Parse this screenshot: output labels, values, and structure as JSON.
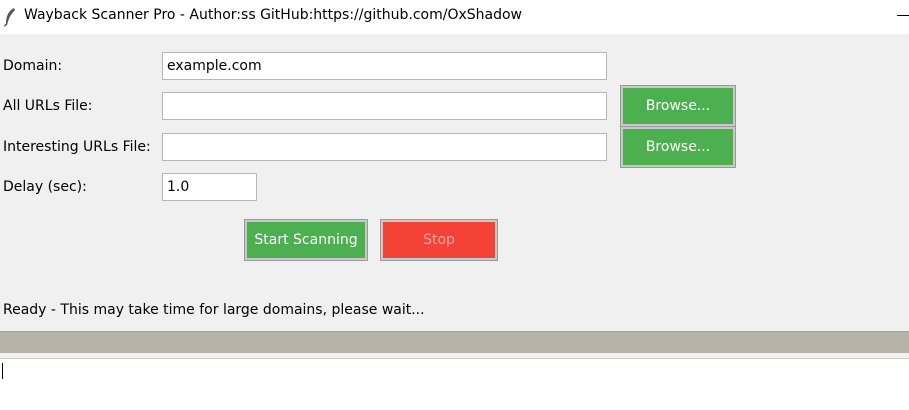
{
  "window": {
    "title": "Wayback Scanner Pro - Author:ss GitHub:https://github.com/OxShadow",
    "icon": "feather-icon"
  },
  "form": {
    "domain_label": "Domain:",
    "domain_value": "example.com",
    "all_urls_label": "All URLs File:",
    "all_urls_value": "",
    "interesting_label": "Interesting URLs File:",
    "interesting_value": "",
    "delay_label": "Delay (sec):",
    "delay_value": "1.0",
    "browse_label": "Browse..."
  },
  "actions": {
    "start_label": "Start Scanning",
    "stop_label": "Stop",
    "start_color": "#4caf50",
    "stop_color": "#f44336"
  },
  "status": {
    "text": "Ready - This may take time for large domains, please wait...",
    "progress": 0
  },
  "log": {
    "text": ""
  }
}
